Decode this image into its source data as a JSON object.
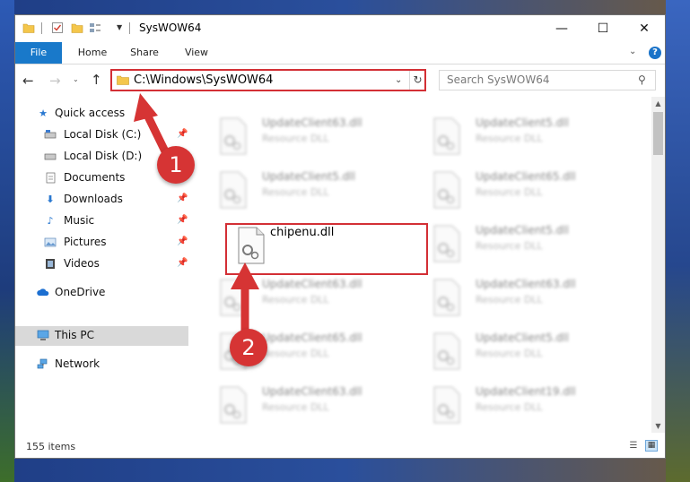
{
  "window": {
    "title": "SysWOW64",
    "min_symbol": "—",
    "max_symbol": "☐",
    "close_symbol": "✕"
  },
  "quick_access_toolbar": {
    "icons": [
      "folder-icon",
      "properties-icon",
      "new-folder-icon",
      "view-icon",
      "customize-dropdown-icon"
    ]
  },
  "ribbon": {
    "tabs": [
      {
        "label": "File",
        "active": true
      },
      {
        "label": "Home"
      },
      {
        "label": "Share"
      },
      {
        "label": "View"
      }
    ],
    "accent_color": "#1979ca"
  },
  "navigation": {
    "address": "C:\\Windows\\SysWOW64",
    "search_placeholder": "Search SysWOW64"
  },
  "sidebar": {
    "items": [
      {
        "label": "Quick access",
        "icon": "star-icon"
      },
      {
        "label": "Local Disk (C:)",
        "icon": "drive-icon",
        "pinned": true
      },
      {
        "label": "Local Disk (D:)",
        "icon": "drive-icon"
      },
      {
        "label": "Documents",
        "icon": "documents-icon",
        "pinned": true
      },
      {
        "label": "Downloads",
        "icon": "download-icon",
        "pinned": true
      },
      {
        "label": "Music",
        "icon": "music-icon",
        "pinned": true
      },
      {
        "label": "Pictures",
        "icon": "pictures-icon",
        "pinned": true
      },
      {
        "label": "Videos",
        "icon": "videos-icon",
        "pinned": true
      },
      {
        "label": "OneDrive",
        "icon": "cloud-icon"
      },
      {
        "label": "This PC",
        "icon": "computer-icon",
        "selected": true
      },
      {
        "label": "Network",
        "icon": "network-icon"
      }
    ]
  },
  "files": [
    {
      "name": "UpdateClient63.dll",
      "type": "Resource DLL"
    },
    {
      "name": "UpdateClient5.dll",
      "type": "Resource DLL"
    },
    {
      "name": "UpdateClient5.dll",
      "type": "Resource DLL"
    },
    {
      "name": "UpdateClient65.dll",
      "type": "Resource DLL"
    },
    {
      "name": "chipenu.dll",
      "type": "",
      "highlighted": true
    },
    {
      "name": "UpdateClient5.dll",
      "type": "Resource DLL"
    },
    {
      "name": "UpdateClient63.dll",
      "type": "Resource DLL"
    },
    {
      "name": "UpdateClient63.dll",
      "type": "Resource DLL"
    },
    {
      "name": "UpdateClient65.dll",
      "type": "Resource DLL"
    },
    {
      "name": "UpdateClient5.dll",
      "type": "Resource DLL"
    },
    {
      "name": "UpdateClient63.dll",
      "type": "Resource DLL"
    },
    {
      "name": "UpdateClient19.dll",
      "type": "Resource DLL"
    }
  ],
  "status": {
    "item_count": "155 items"
  },
  "annotations": {
    "step1": "1",
    "step2": "2",
    "color": "#d63434"
  }
}
